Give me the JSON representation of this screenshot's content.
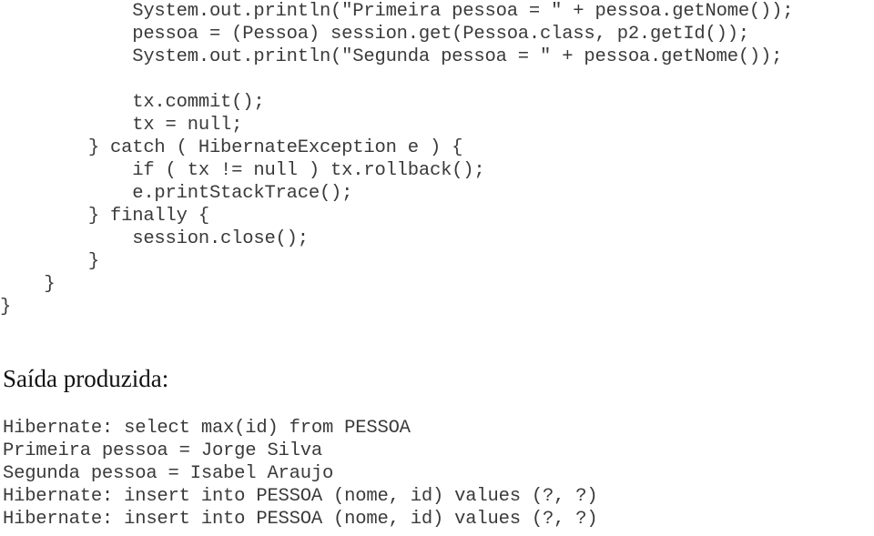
{
  "code_block": {
    "lines": [
      "            System.out.println(\"Primeira pessoa = \" + pessoa.getNome());",
      "            pessoa = (Pessoa) session.get(Pessoa.class, p2.getId());",
      "            System.out.println(\"Segunda pessoa = \" + pessoa.getNome());",
      "",
      "            tx.commit();",
      "            tx = null;",
      "        } catch ( HibernateException e ) {",
      "            if ( tx != null ) tx.rollback();",
      "            e.printStackTrace();",
      "        } finally {",
      "            session.close();",
      "        }",
      "    }",
      "}"
    ]
  },
  "heading": {
    "text": "Saída produzida:"
  },
  "output_block": {
    "lines": [
      "Hibernate: select max(id) from PESSOA",
      "Primeira pessoa = Jorge Silva",
      "Segunda pessoa = Isabel Araujo",
      "Hibernate: insert into PESSOA (nome, id) values (?, ?)",
      "Hibernate: insert into PESSOA (nome, id) values (?, ?)"
    ]
  },
  "colors": {
    "page_background": "#ffffff",
    "code_text": "#3a3a3a",
    "heading_text": "#111111",
    "output_text": "#3a3a3a"
  }
}
